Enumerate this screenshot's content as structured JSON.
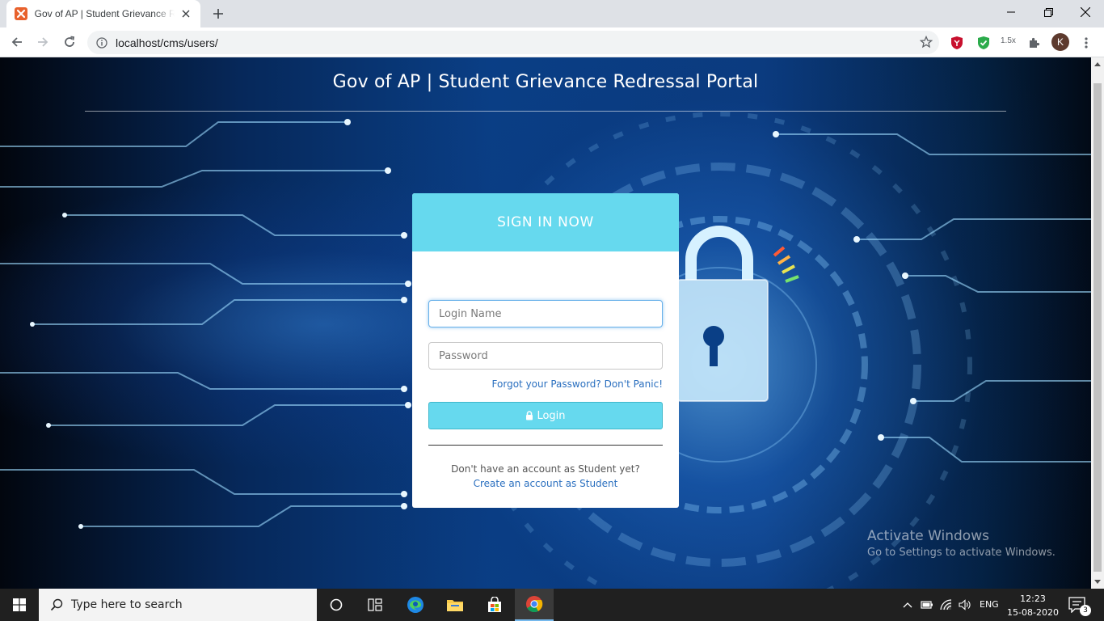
{
  "browser": {
    "tab_title": "Gov of AP | Student Grievance Redressal Portal",
    "url": "localhost/cms/users/",
    "zoom_badge": "1.5x",
    "profile_initial": "K"
  },
  "page": {
    "title": "Gov of AP | Student Grievance Redressal Portal"
  },
  "login_card": {
    "heading": "SIGN IN NOW",
    "login_placeholder": "Login Name",
    "password_placeholder": "Password",
    "forgot_link": "Forgot your Password? Don't Panic!",
    "login_button": "Login",
    "no_account_text": "Don't have an account as Student yet?",
    "create_link": "Create an account as Student"
  },
  "watermark": {
    "line1": "Activate Windows",
    "line2": "Go to Settings to activate Windows."
  },
  "taskbar": {
    "search_placeholder": "Type here to search",
    "language": "ENG",
    "time": "12:23",
    "date": "15-08-2020",
    "notification_count": "3"
  },
  "colors": {
    "card_header": "#66d9ee",
    "link": "#2a6fbf",
    "page_bg": "#0a3f86"
  }
}
